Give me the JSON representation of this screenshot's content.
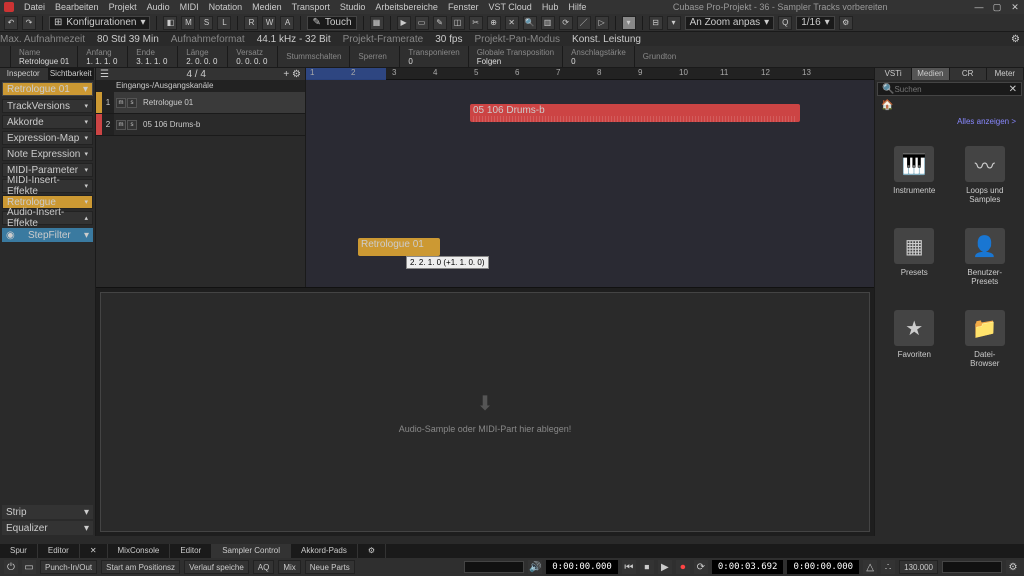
{
  "app": {
    "title": "Cubase Pro-Projekt - 36 - Sampler Tracks vorbereiten"
  },
  "menu": [
    "Datei",
    "Bearbeiten",
    "Projekt",
    "Audio",
    "MIDI",
    "Notation",
    "Medien",
    "Transport",
    "Studio",
    "Arbeitsbereiche",
    "Fenster",
    "VST Cloud",
    "Hub",
    "Hilfe"
  ],
  "toolbar": {
    "config": "Konfigurationen",
    "touch": "Touch",
    "quant": "1/16",
    "zoom": "An Zoom anpas"
  },
  "info": {
    "rec_label": "Max. Aufnahmezeit",
    "rec_value": "80 Std 39 Min",
    "fmt_label": "Aufnahmeformat",
    "fmt_value": "44.1 kHz - 32 Bit",
    "fps_label": "Projekt-Framerate",
    "fps_value": "30 fps",
    "pan_label": "Projekt-Pan-Modus",
    "pan_value": "Konst. Leistung"
  },
  "params": [
    {
      "label": "Name",
      "value": "Retrologue 01"
    },
    {
      "label": "Anfang",
      "value": "1. 1. 1.  0"
    },
    {
      "label": "Ende",
      "value": "3. 1. 1.  0"
    },
    {
      "label": "Länge",
      "value": "2. 0. 0.  0"
    },
    {
      "label": "Versatz",
      "value": "0. 0. 0.  0"
    },
    {
      "label": "Stummschalten",
      "value": ""
    },
    {
      "label": "Sperren",
      "value": ""
    },
    {
      "label": "Transponieren",
      "value": "0"
    },
    {
      "label": "Globale Transposition",
      "value": "Folgen"
    },
    {
      "label": "Anschlagstärke",
      "value": "0"
    },
    {
      "label": "Grundton",
      "value": ""
    }
  ],
  "left_tabs": {
    "t1": "Inspector",
    "t2": "Sichtbarkeit"
  },
  "inspector": {
    "track_name": "Retrologue 01",
    "rows": [
      "TrackVersions",
      "Akkorde",
      "Expression-Map",
      "Note Expression",
      "MIDI-Parameter",
      "MIDI-Insert-Effekte"
    ],
    "retro": "Retrologue",
    "audio_ins": "Audio-Insert-Effekte",
    "stepfilter": "StepFilter",
    "strip": "Strip",
    "eq": "Equalizer"
  },
  "tracklist": {
    "count": "4 / 4",
    "io": "Eingangs-/Ausgangskanäle",
    "tracks": [
      {
        "name": "Retrologue 01",
        "color": "#cc9933",
        "num": "1",
        "btns": [
          "m",
          "s"
        ]
      },
      {
        "name": "05 106 Drums-b",
        "color": "#c44",
        "num": "2",
        "btns": [
          "m",
          "s"
        ]
      }
    ]
  },
  "clips": {
    "audio": "05 106 Drums-b",
    "midi": "Retrologue 01",
    "tooltip": "2. 2. 1.  0 (+1. 1. 0.  0)"
  },
  "editor_hint": "Audio-Sample oder MIDI-Part hier ablegen!",
  "right_tabs": [
    "VSTi",
    "Medien",
    "CR",
    "Meter"
  ],
  "search_placeholder": "Suchen",
  "show_all": "Alles anzeigen >",
  "media": [
    {
      "label": "Instrumente",
      "icon": "piano"
    },
    {
      "label": "Loops und Samples",
      "icon": "wave"
    },
    {
      "label": "Presets",
      "icon": "grid"
    },
    {
      "label": "Benutzer-Presets",
      "icon": "user"
    },
    {
      "label": "Favoriten",
      "icon": "star"
    },
    {
      "label": "Datei-Browser",
      "icon": "folder"
    }
  ],
  "bottom_tabs": [
    "Spur",
    "Editor",
    "",
    "MixConsole",
    "Editor",
    "Sampler Control",
    "Akkord-Pads"
  ],
  "transport": {
    "punch": "Punch-In/Out",
    "start": "Start am Positionsz",
    "verlauf": "Verlauf speiche",
    "aq": "AQ",
    "mix": "Mix",
    "newparts": "Neue Parts",
    "time1": "0:00:00.000",
    "time2": "0:00:03.692",
    "time3": "0:00:00.000",
    "tempo": "130.000"
  }
}
